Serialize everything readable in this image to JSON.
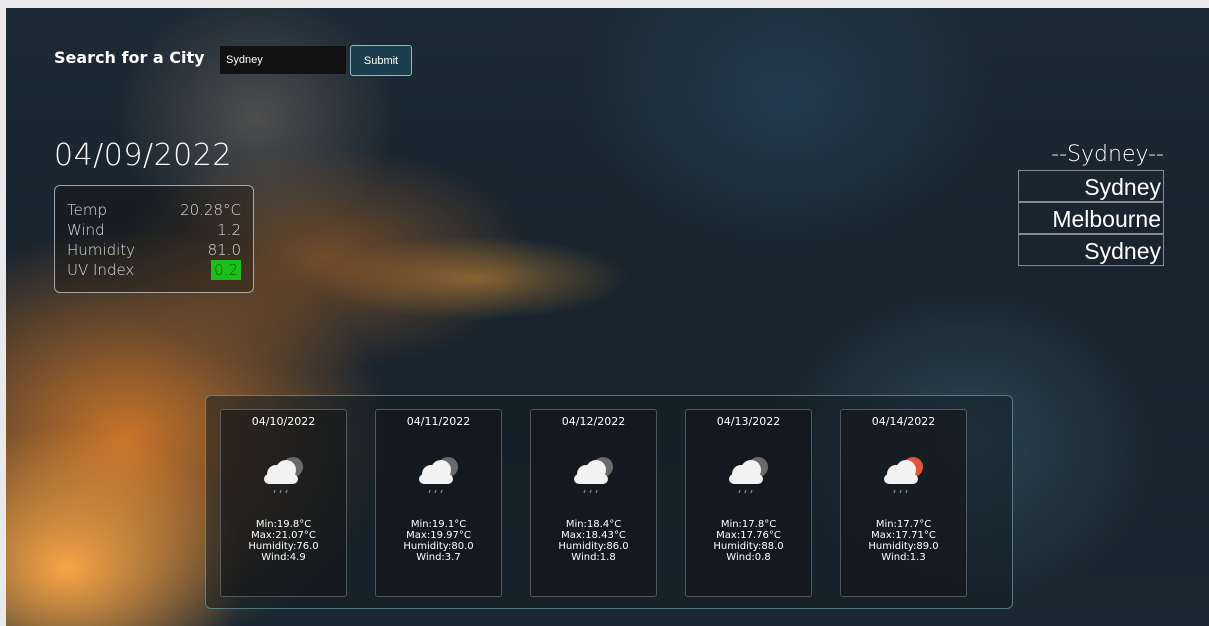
{
  "search": {
    "label": "Search for a City",
    "value": "Sydney",
    "submit_label": "Submit"
  },
  "current": {
    "date": "04/09/2022",
    "temp_label": "Temp",
    "temp_value": "20.28°C",
    "wind_label": "Wind",
    "wind_value": "1.2",
    "humidity_label": "Humidity",
    "humidity_value": "81.0",
    "uv_label": "UV Index",
    "uv_value": "0.2",
    "uv_color": "#1bbf1b"
  },
  "history": {
    "title": "--Sydney--",
    "items": [
      "Sydney",
      "Melbourne",
      "Sydney"
    ]
  },
  "forecast": [
    {
      "date": "04/10/2022",
      "icon": "cloud-rain-moon-icon",
      "min": "Min:19.8°C",
      "max": "Max:21.07°C",
      "humidity": "Humidity:76.0",
      "wind": "Wind:4.9"
    },
    {
      "date": "04/11/2022",
      "icon": "cloud-rain-moon-icon",
      "min": "Min:19.1°C",
      "max": "Max:19.97°C",
      "humidity": "Humidity:80.0",
      "wind": "Wind:3.7"
    },
    {
      "date": "04/12/2022",
      "icon": "cloud-rain-moon-icon",
      "min": "Min:18.4°C",
      "max": "Max:18.43°C",
      "humidity": "Humidity:86.0",
      "wind": "Wind:1.8"
    },
    {
      "date": "04/13/2022",
      "icon": "cloud-rain-moon-icon",
      "min": "Min:17.8°C",
      "max": "Max:17.76°C",
      "humidity": "Humidity:88.0",
      "wind": "Wind:0.8"
    },
    {
      "date": "04/14/2022",
      "icon": "cloud-rain-sun-icon",
      "min": "Min:17.7°C",
      "max": "Max:17.71°C",
      "humidity": "Humidity:89.0",
      "wind": "Wind:1.3"
    }
  ],
  "colors": {
    "moon": "#6a6a6a",
    "sun": "#e2553a",
    "cloud": "#f2f2f2"
  }
}
